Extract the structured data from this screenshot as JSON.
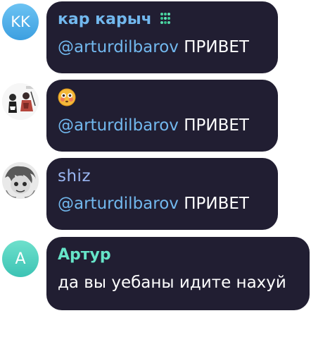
{
  "messages": [
    {
      "avatar_initials": "KK",
      "sender": "кар карыч",
      "sender_emoji_status": "green-cluster-icon",
      "mention": "@arturdilbarov",
      "text": " ПРИВЕТ"
    },
    {
      "avatar_image": "anime-figures-sketch",
      "sender_emoji": "flushed-face-icon",
      "mention": "@arturdilbarov",
      "text": " ПРИВЕТ"
    },
    {
      "avatar_image": "manga-character-sketch",
      "sender": "shiz",
      "mention": "@arturdilbarov",
      "text": " ПРИВЕТ"
    },
    {
      "avatar_initials": "A",
      "sender": "Артур",
      "text": "да вы уебаны идите нахуй"
    }
  ],
  "colors": {
    "bubble": "#211e32",
    "mention": "#72b8ee",
    "sender_blue": "#72b8ee",
    "sender_teal": "#66e4c8",
    "avatar_kk": "#4aa9e6",
    "avatar_a": "#4fd2be"
  }
}
